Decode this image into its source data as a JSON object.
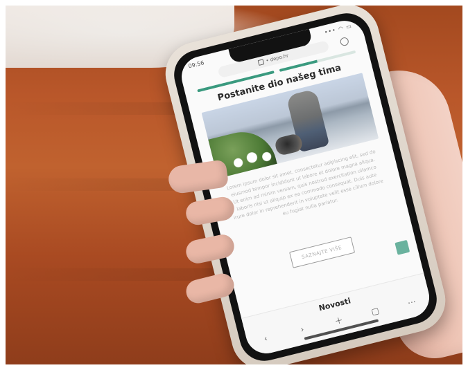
{
  "phone": {
    "status": {
      "time": "09:56",
      "signal": "••• ◠ ▭"
    },
    "browser": {
      "url": "• depo.hr"
    },
    "progress": {
      "segments": [
        {
          "filled_fraction": 1.0
        },
        {
          "filled_fraction": 0.5
        }
      ],
      "accent": "#3a9a7f"
    },
    "page": {
      "title": "Postanite dio našeg tima",
      "paragraph": "Lorem ipsum dolor sit amet, consectetur adipiscing elit, sed do eiusmod tempor incididunt ut labore et dolore magna aliqua. Ut enim ad minim veniam, quis nostrud exercitation ullamco laboris nisi ut aliquip ex ea commodo consequat. Duis aute irure dolor in reprehenderit in voluptate velit esse cillum dolore eu fugiat nulla pariatur.",
      "cta_label": "SAZNAJTE VIŠE"
    },
    "bottom": {
      "title": "Novosti",
      "nav_icons": [
        "back-icon",
        "forward-icon",
        "plus-icon",
        "tabs-icon",
        "menu-icon"
      ]
    }
  }
}
